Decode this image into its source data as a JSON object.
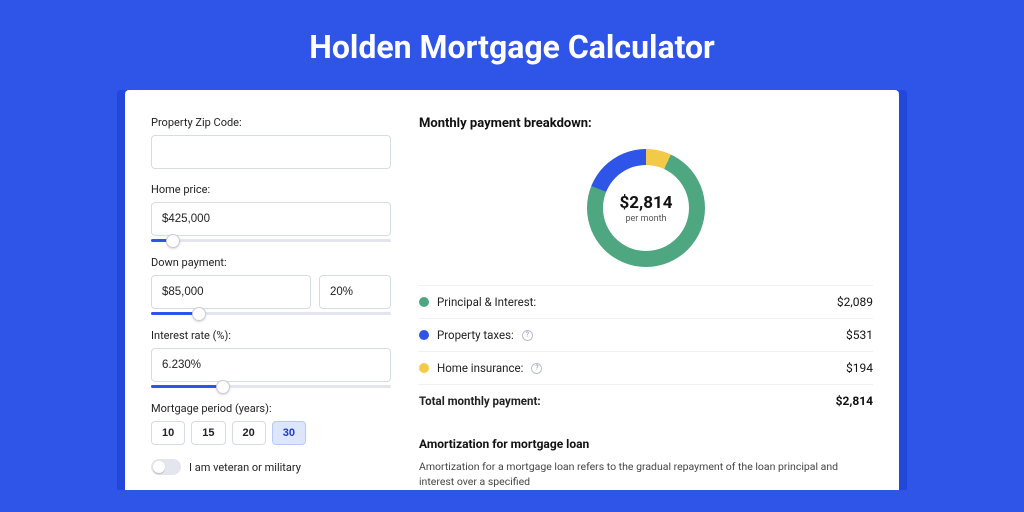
{
  "title": "Holden Mortgage Calculator",
  "form": {
    "zip": {
      "label": "Property Zip Code:",
      "value": ""
    },
    "home_price": {
      "label": "Home price:",
      "value": "$425,000",
      "slider_pct": 9
    },
    "down_payment": {
      "label": "Down payment:",
      "value": "$85,000",
      "pct_value": "20%",
      "slider_pct": 20
    },
    "interest": {
      "label": "Interest rate (%):",
      "value": "6.230%",
      "slider_pct": 30
    },
    "period": {
      "label": "Mortgage period (years):",
      "options": [
        "10",
        "15",
        "20",
        "30"
      ],
      "active_index": 3
    },
    "veteran_label": "I am veteran or military"
  },
  "breakdown": {
    "title": "Monthly payment breakdown:",
    "center_value": "$2,814",
    "center_sub": "per month",
    "items": [
      {
        "label": "Principal & Interest:",
        "value": "$2,089",
        "color": "#4fa781",
        "info": false
      },
      {
        "label": "Property taxes:",
        "value": "$531",
        "color": "#2e54e8",
        "info": true
      },
      {
        "label": "Home insurance:",
        "value": "$194",
        "color": "#f3c948",
        "info": true
      }
    ],
    "total_label": "Total monthly payment:",
    "total_value": "$2,814"
  },
  "amort": {
    "title": "Amortization for mortgage loan",
    "text": "Amortization for a mortgage loan refers to the gradual repayment of the loan principal and interest over a specified"
  },
  "chart_data": {
    "type": "pie",
    "title": "Monthly payment breakdown",
    "series": [
      {
        "name": "Principal & Interest",
        "value": 2089,
        "color": "#4fa781"
      },
      {
        "name": "Property taxes",
        "value": 531,
        "color": "#2e54e8"
      },
      {
        "name": "Home insurance",
        "value": 194,
        "color": "#f3c948"
      }
    ],
    "total": 2814,
    "center_label": "$2,814 per month"
  }
}
